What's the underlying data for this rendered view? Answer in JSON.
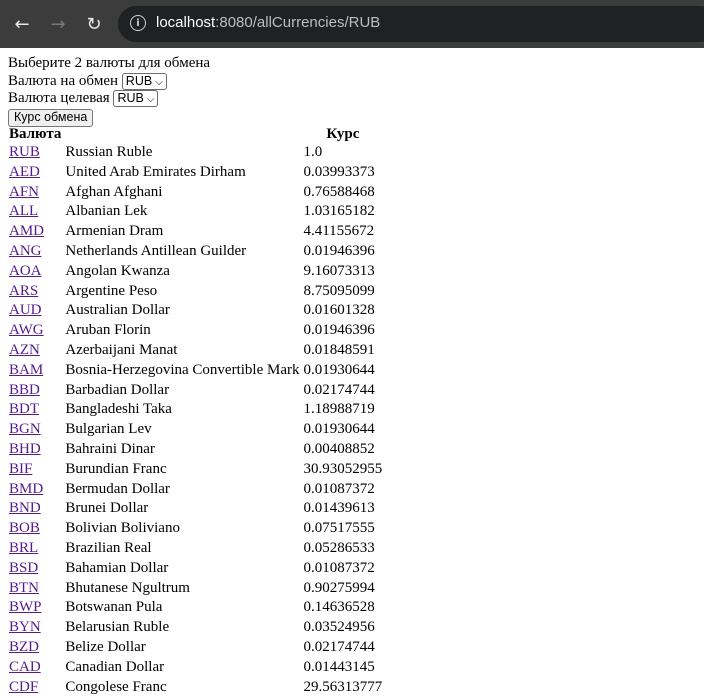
{
  "browser": {
    "back_icon": "arrow-left",
    "forward_icon": "arrow-right",
    "reload_icon": "reload",
    "url_host": "localhost",
    "url_path": ":8080/allCurrencies/RUB"
  },
  "form": {
    "heading": "Выберите 2 валюты для обмена",
    "from_label": "Валюта на обмен",
    "from_value": "RUB",
    "to_label": "Валюта целевая",
    "to_value": "RUB",
    "submit_label": "Курс обмена"
  },
  "table": {
    "headers": [
      "Валюта",
      "Курс"
    ],
    "rows": [
      [
        "RUB",
        "Russian Ruble",
        "1.0"
      ],
      [
        "AED",
        "United Arab Emirates Dirham",
        "0.03993373"
      ],
      [
        "AFN",
        "Afghan Afghani",
        "0.76588468"
      ],
      [
        "ALL",
        "Albanian Lek",
        "1.03165182"
      ],
      [
        "AMD",
        "Armenian Dram",
        "4.41155672"
      ],
      [
        "ANG",
        "Netherlands Antillean Guilder",
        "0.01946396"
      ],
      [
        "AOA",
        "Angolan Kwanza",
        "9.16073313"
      ],
      [
        "ARS",
        "Argentine Peso",
        "8.75095099"
      ],
      [
        "AUD",
        "Australian Dollar",
        "0.01601328"
      ],
      [
        "AWG",
        "Aruban Florin",
        "0.01946396"
      ],
      [
        "AZN",
        "Azerbaijani Manat",
        "0.01848591"
      ],
      [
        "BAM",
        "Bosnia-Herzegovina Convertible Mark",
        "0.01930644"
      ],
      [
        "BBD",
        "Barbadian Dollar",
        "0.02174744"
      ],
      [
        "BDT",
        "Bangladeshi Taka",
        "1.18988719"
      ],
      [
        "BGN",
        "Bulgarian Lev",
        "0.01930644"
      ],
      [
        "BHD",
        "Bahraini Dinar",
        "0.00408852"
      ],
      [
        "BIF",
        "Burundian Franc",
        "30.93052955"
      ],
      [
        "BMD",
        "Bermudan Dollar",
        "0.01087372"
      ],
      [
        "BND",
        "Brunei Dollar",
        "0.01439613"
      ],
      [
        "BOB",
        "Bolivian Boliviano",
        "0.07517555"
      ],
      [
        "BRL",
        "Brazilian Real",
        "0.05286533"
      ],
      [
        "BSD",
        "Bahamian Dollar",
        "0.01087372"
      ],
      [
        "BTN",
        "Bhutanese Ngultrum",
        "0.90275994"
      ],
      [
        "BWP",
        "Botswanan Pula",
        "0.14636528"
      ],
      [
        "BYN",
        "Belarusian Ruble",
        "0.03524956"
      ],
      [
        "BZD",
        "Belize Dollar",
        "0.02174744"
      ],
      [
        "CAD",
        "Canadian Dollar",
        "0.01443145"
      ],
      [
        "CDF",
        "Congolese Franc",
        "29.56313777"
      ]
    ]
  }
}
